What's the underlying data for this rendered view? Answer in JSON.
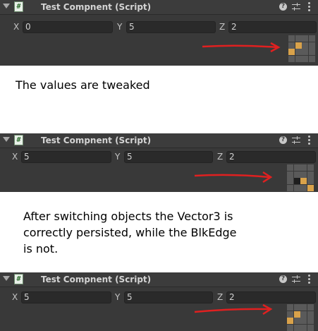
{
  "panels": [
    {
      "title": "Test Compnent (Script)",
      "x_label": "X",
      "x_value": "0",
      "y_label": "Y",
      "y_value": "5",
      "z_label": "Z",
      "z_value": "2",
      "grid": [
        [
          "e",
          "e",
          "e",
          "e"
        ],
        [
          "e",
          "o",
          "e",
          "e"
        ],
        [
          "o",
          "e",
          "e",
          "e"
        ],
        [
          "e",
          "e",
          "e",
          "e"
        ]
      ]
    },
    {
      "title": "Test Compnent (Script)",
      "x_label": "X",
      "x_value": "5",
      "y_label": "Y",
      "y_value": "5",
      "z_label": "Z",
      "z_value": "2",
      "grid": [
        [
          "e",
          "e",
          "e",
          "e"
        ],
        [
          "e",
          "e",
          "e",
          "e"
        ],
        [
          "e",
          "d",
          "o",
          "e"
        ],
        [
          "e",
          "e",
          "e",
          "o"
        ]
      ]
    },
    {
      "title": "Test Compnent (Script)",
      "x_label": "X",
      "x_value": "5",
      "y_label": "Y",
      "y_value": "5",
      "z_label": "Z",
      "z_value": "2",
      "grid": [
        [
          "e",
          "e",
          "e",
          "e"
        ],
        [
          "e",
          "o",
          "e",
          "e"
        ],
        [
          "o",
          "e",
          "e",
          "e"
        ],
        [
          "e",
          "e",
          "e",
          "e"
        ]
      ]
    }
  ],
  "captions": {
    "first": "The values are tweaked",
    "second_line1": "After switching objects the Vector3 is",
    "second_line2": "correctly persisted, while the BlkEdge",
    "second_line3": "is not."
  },
  "icons": {
    "foldout": "foldout-triangle-icon",
    "script": "csharp-script-icon",
    "script_glyph": "#",
    "help": "help-icon",
    "help_glyph": "?",
    "preset": "preset-sliders-icon",
    "menu": "kebab-menu-icon"
  },
  "colors": {
    "panel_bg": "#393939",
    "field_bg": "#2a2a2a",
    "cell_empty": "#5a5a5a",
    "cell_orange": "#d9a24a",
    "cell_dark": "#1e1e1e",
    "arrow": "#e02020"
  }
}
